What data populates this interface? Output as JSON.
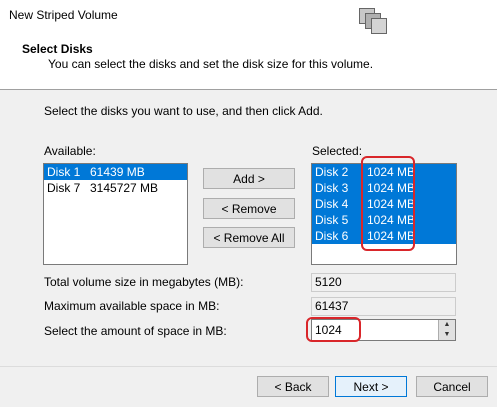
{
  "window": {
    "title": "New Striped Volume"
  },
  "header": {
    "title": "Select Disks",
    "subtitle": "You can select the disks and set the disk size for this volume."
  },
  "instruction": "Select the disks you want to use, and then click Add.",
  "available": {
    "label": "Available:",
    "items": [
      {
        "disk": "Disk 1",
        "size": "61439 MB",
        "selected": true
      },
      {
        "disk": "Disk 7",
        "size": "3145727 MB",
        "selected": false
      }
    ]
  },
  "selected": {
    "label": "Selected:",
    "items": [
      {
        "disk": "Disk 2",
        "size": "1024 MB"
      },
      {
        "disk": "Disk 3",
        "size": "1024 MB"
      },
      {
        "disk": "Disk 4",
        "size": "1024 MB"
      },
      {
        "disk": "Disk 5",
        "size": "1024 MB"
      },
      {
        "disk": "Disk 6",
        "size": "1024 MB"
      }
    ]
  },
  "buttons": {
    "add": "Add >",
    "remove": "< Remove",
    "remove_all": "< Remove All",
    "back": "< Back",
    "next": "Next >",
    "cancel": "Cancel"
  },
  "fields": {
    "total_label": "Total volume size in megabytes (MB):",
    "total_value": "5120",
    "max_label": "Maximum available space in MB:",
    "max_value": "61437",
    "amount_label": "Select the amount of space in MB:",
    "amount_value": "1024"
  },
  "colors": {
    "selection": "#0078d7",
    "highlight_annotation": "#d9262a"
  },
  "icons": {
    "wizard_graphic": "disk-stack-icon",
    "spin_up": "up-arrow-icon",
    "spin_down": "down-arrow-icon"
  }
}
